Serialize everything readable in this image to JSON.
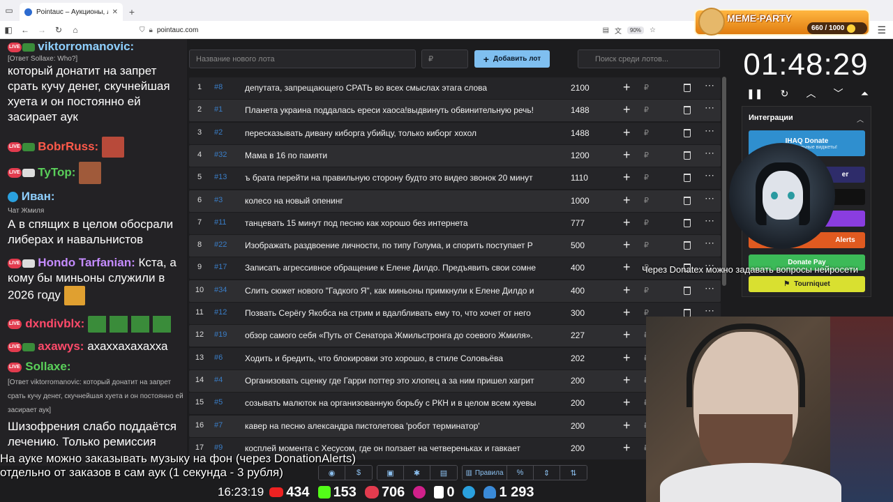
{
  "browser": {
    "tab_title": "Pointauc – Аукционы, лотереи",
    "url": "pointauc.com",
    "zoom": "90%"
  },
  "meme_party": {
    "title": "MEME-PARTY",
    "score": "660 / 1000"
  },
  "chat": [
    {
      "nick": "viktorromanovic:",
      "nick_color": "#8fd0ff",
      "reply": "[Ответ Sollaxe: Who?]",
      "text": "который донатит на запрет срать кучу денег, скучнейшая хуета и он постоянно ей засирает аук"
    },
    {
      "nick": "BobrRuss:",
      "nick_color": "#ff5a4a"
    },
    {
      "nick": "TyTop:",
      "nick_color": "#5ad05a"
    },
    {
      "nick": "Иван:",
      "nick_color": "#8fd0ff",
      "reply": "Чат Жмиля",
      "text": "А в спящих в целом обосрали либерах и навальнистов"
    },
    {
      "nick": "Hondo Tarfanian:",
      "nick_color": "#c58cff",
      "text": "Кста, а кому бы миньоны служили в 2026 году"
    },
    {
      "nick": "dxndivblx:",
      "nick_color": "#ff4a6a"
    },
    {
      "nick": "axawys:",
      "nick_color": "#ff4a6a",
      "text": "ахаххахахахха"
    },
    {
      "nick": "Sollaxe:",
      "nick_color": "#5ad05a",
      "reply": "[Ответ viktorromanovic: который донатит на запрет срать кучу денег, скучнейшая хуета и он постоянно ей засирает аук]",
      "text": "Шизофрения слабо поддаётся лечению. Только ремиссия"
    }
  ],
  "toolbar": {
    "lot_name_placeholder": "Название нового лота",
    "amount_placeholder": "₽",
    "add_lot_label": "Добавить лот",
    "search_placeholder": "Поиск среди лотов..."
  },
  "lots": [
    {
      "n": "1",
      "id": "#8",
      "title": "депутата, запрещающего СРАТЬ во всех смыслах этага слова",
      "amount": "2100"
    },
    {
      "n": "2",
      "id": "#1",
      "title": "Планета украина поддалась ереси хаоса!выдвинуть обвинительную речь!",
      "amount": "1488"
    },
    {
      "n": "3",
      "id": "#2",
      "title": "пересказывать дивану киборга убийцу, только киборг хохол",
      "amount": "1488"
    },
    {
      "n": "4",
      "id": "#32",
      "title": "Мама в 16 по памяти",
      "amount": "1200"
    },
    {
      "n": "5",
      "id": "#13",
      "title": "ъ брата перейти на правильную сторону будто это видео звонок 20 минут",
      "amount": "1110"
    },
    {
      "n": "6",
      "id": "#3",
      "title": "колесо на новый опенинг",
      "amount": "1000"
    },
    {
      "n": "7",
      "id": "#11",
      "title": "танцевать 15 минут под песню как хорошо без интернета",
      "amount": "777"
    },
    {
      "n": "8",
      "id": "#22",
      "title": "Изображать раздвоение личности, по типу Голума, и спорить поступает Р",
      "amount": "500"
    },
    {
      "n": "9",
      "id": "#17",
      "title": "Записать агрессивное обращение к Елене Дилдо. Предъявить свои сомне",
      "amount": "400"
    },
    {
      "n": "10",
      "id": "#34",
      "title": "Слить сюжет нового \"Гадкого Я\", как миньоны примкнули к Елене Дилдо и",
      "amount": "400"
    },
    {
      "n": "11",
      "id": "#12",
      "title": "Позвать Серёгу Якобса на стрим и вдалбливать ему то, что хочет от него",
      "amount": "300"
    },
    {
      "n": "12",
      "id": "#19",
      "title": "обзор самого себя «Путь от Сенатора Жмильстронга до соевого Жмиля».",
      "amount": "227"
    },
    {
      "n": "13",
      "id": "#6",
      "title": "Ходить и бредить, что блокировки это хорошо, в стиле Соловьёва",
      "amount": "202"
    },
    {
      "n": "14",
      "id": "#4",
      "title": "Организовать сценку где Гарри поттер это хлопец а за ним пришел хагрит",
      "amount": "200"
    },
    {
      "n": "15",
      "id": "#5",
      "title": "созывать малюток на организованную борьбу с РКН и в целом всем хуевы",
      "amount": "200"
    },
    {
      "n": "16",
      "id": "#7",
      "title": "кавер на песню александра пистолетова 'робот терминатор'",
      "amount": "200"
    },
    {
      "n": "17",
      "id": "#9",
      "title": "косплей момента с Хесусом, где он ползает на четвереньках и гавкает",
      "amount": "200"
    }
  ],
  "timer": {
    "value": "01:48:29"
  },
  "integrations": {
    "title": "Интеграции",
    "ihaq_label": "IHAQ Donate",
    "ihaq_sub": "Ко... уникальные виджеты!",
    "purple_label": "er",
    "alerts_label": "Alerts",
    "donatepay_label": "Donate Pay",
    "tourniquet_label": "Tourniquet"
  },
  "overlay": {
    "donatex_text": "Через Donatex можно задавать вопросы нейросети",
    "music_line1": "На ауке можно заказывать музыку на фон (через DonationAlerts)",
    "music_line2": "отдельно от заказов в сам аук (1 секунда - 3 рубля)"
  },
  "bottom_toolbar": {
    "rules_label": "Правила"
  },
  "stats": {
    "time": "16:23:19",
    "youtube": "434",
    "kick": "153",
    "live": "706",
    "rutube": "0",
    "r_platform": "0",
    "total": "1 293"
  },
  "colors": {
    "accent": "#7fbff0",
    "id_blue": "#3a7ec8",
    "row_dark": "#252528",
    "row_light": "#2e2e31"
  }
}
